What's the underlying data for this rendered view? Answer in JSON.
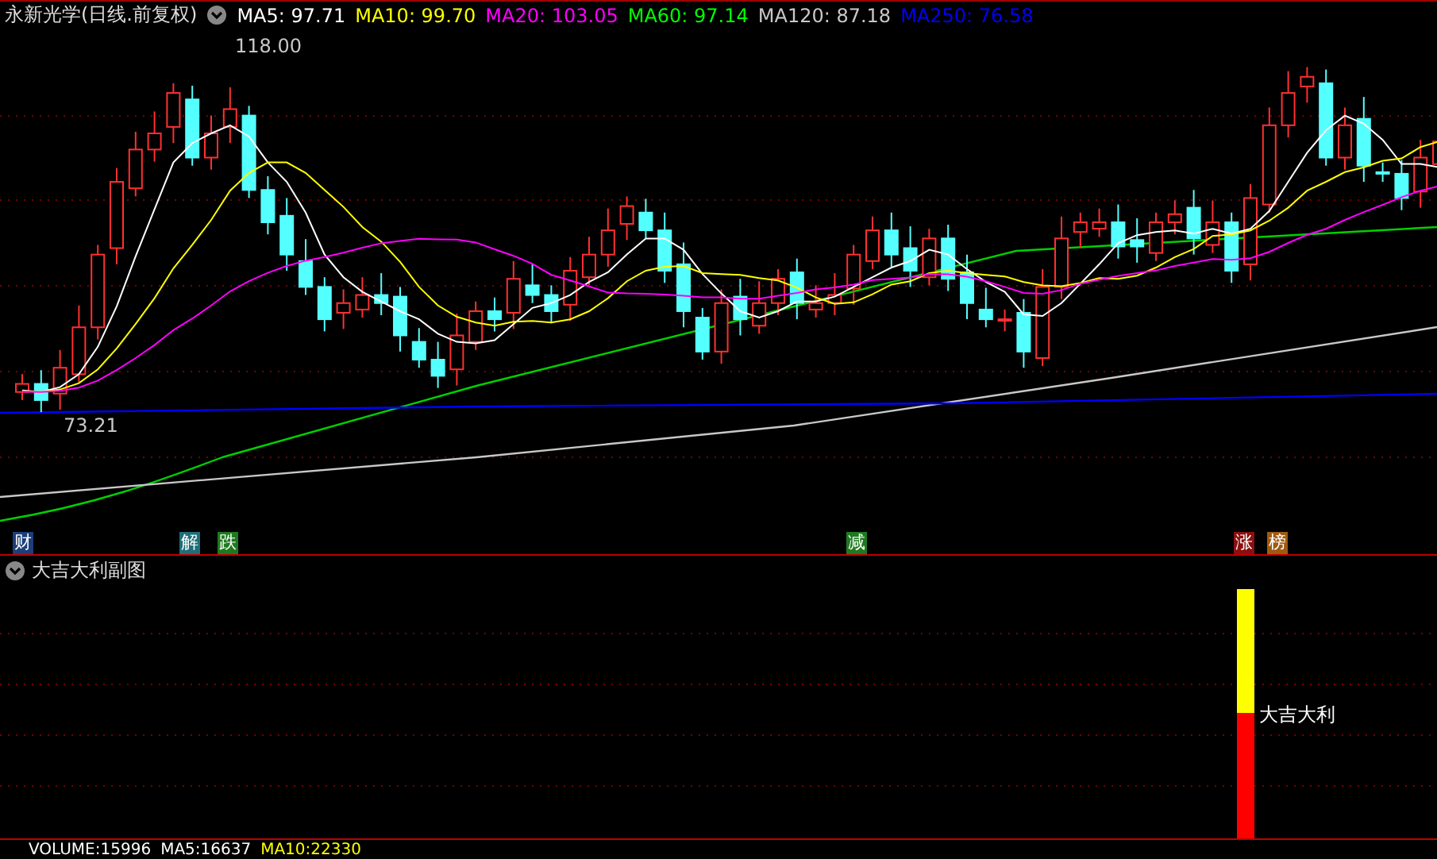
{
  "header": {
    "title": "永新光学(日线.前复权)",
    "indicators": [
      {
        "label": "MA5: 97.71",
        "color": "#ffffff"
      },
      {
        "label": "MA10: 99.70",
        "color": "#ffff00"
      },
      {
        "label": "MA20: 103.05",
        "color": "#ff00ff"
      },
      {
        "label": "MA60: 97.14",
        "color": "#00ff00"
      },
      {
        "label": "MA120: 87.18",
        "color": "#c8c8c8"
      },
      {
        "label": "MA250: 76.58",
        "color": "#0000ff"
      }
    ]
  },
  "main_chart": {
    "high_label": "118.00",
    "low_label": "73.21"
  },
  "signals": [
    {
      "text": "财",
      "color": "#1c3f7a"
    },
    {
      "text": "解",
      "color": "#1f6f7a"
    },
    {
      "text": "跌",
      "color": "#1f7a1f"
    },
    {
      "text": "减",
      "color": "#1f7a1f"
    },
    {
      "text": "涨",
      "color": "#8a1010"
    },
    {
      "text": "榜",
      "color": "#a05a10"
    }
  ],
  "sub_panel": {
    "title": "大吉大利副图",
    "bar_label": "大吉大利"
  },
  "footer": {
    "indicators": [
      {
        "label": "VOLUME:15996",
        "color": "#ffffff"
      },
      {
        "label": "MA5:16637",
        "color": "#ffffff"
      },
      {
        "label": "MA10:22330",
        "color": "#ffff00"
      }
    ]
  }
}
